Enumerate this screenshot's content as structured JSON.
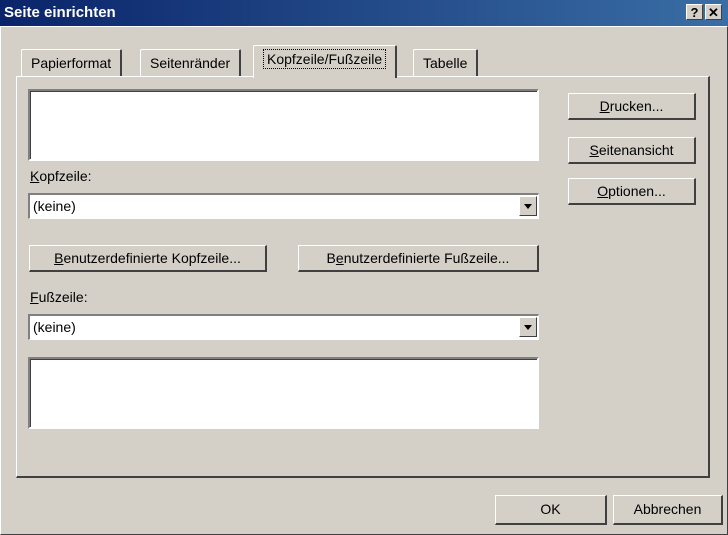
{
  "window": {
    "title": "Seite einrichten",
    "help_icon_glyph": "?",
    "close_icon_glyph": "✕"
  },
  "tabs": [
    {
      "label": "Papierformat"
    },
    {
      "label": "Seitenränder"
    },
    {
      "label": "Kopfzeile/Fußzeile"
    },
    {
      "label": "Tabelle"
    }
  ],
  "header": {
    "label_mnemonic": "K",
    "label_rest": "opfzeile:",
    "value": "(keine)"
  },
  "footer": {
    "label_mnemonic": "F",
    "label_rest": "ußzeile:",
    "value": "(keine)"
  },
  "custom_header_button": {
    "mnemonic": "B",
    "rest": "enutzerdefinierte Kopfzeile..."
  },
  "custom_footer_button": {
    "pre": "B",
    "mnemonic": "e",
    "rest": "nutzerdefinierte Fußzeile..."
  },
  "side_buttons": {
    "print": {
      "mnemonic": "D",
      "rest": "rucken..."
    },
    "preview": {
      "mnemonic": "S",
      "rest": "eitenansicht"
    },
    "options": {
      "mnemonic": "O",
      "rest": "ptionen..."
    }
  },
  "ok_label": "OK",
  "cancel_label": "Abbrechen"
}
